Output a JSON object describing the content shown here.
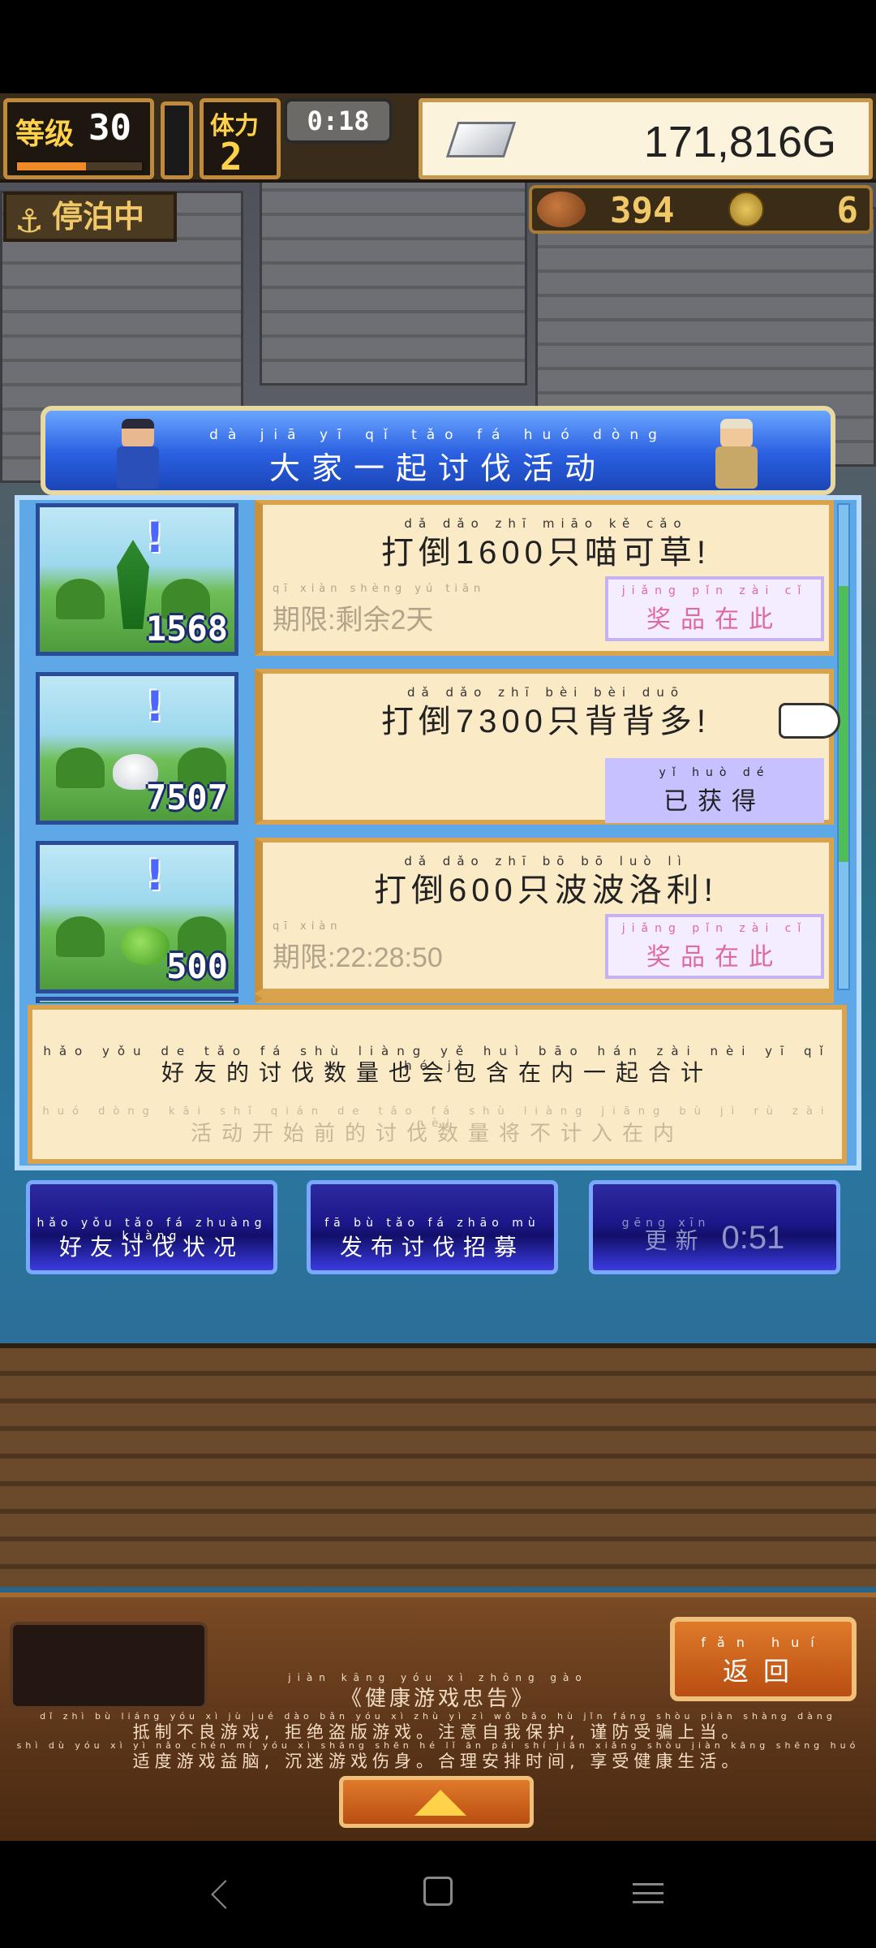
{
  "hud": {
    "level_label": "等级",
    "level_value": "30",
    "exp_fraction": 0.55,
    "stamina_label": "体力",
    "stamina_value": "2",
    "timer": "0:18",
    "money": "171,816G"
  },
  "status": {
    "dock_label": "停泊中",
    "meat_value": "394",
    "coin_value": "6"
  },
  "event": {
    "title_ruby": "dà jiā yī qǐ tǎo fá huó dòng",
    "title": "大家一起讨伐活动",
    "quests": [
      {
        "ruby": "dǎ dǎo zhī miāo kě cǎo",
        "text": "打倒1600只喵可草!",
        "count": "1568",
        "deadline_ruby": "qī xiàn shèng yú tiān",
        "deadline": "期限:剩余2天",
        "button_ruby": "jiǎng pǐn zài cǐ",
        "button_label": "奖品在此",
        "button_state": "prize"
      },
      {
        "ruby": "dǎ dǎo zhī bèi bèi duō",
        "text": "打倒7300只背背多!",
        "count": "7507",
        "deadline_ruby": "",
        "deadline": "",
        "button_ruby": "yǐ huò dé",
        "button_label": "已获得",
        "button_state": "received"
      },
      {
        "ruby": "dǎ dǎo zhī bō bō luò lì",
        "text": "打倒600只波波洛利!",
        "count": "500",
        "deadline_ruby": "qī xiàn",
        "deadline": "期限:22:28:50",
        "button_ruby": "jiǎng pǐn zài cǐ",
        "button_label": "奖品在此",
        "button_state": "prize"
      }
    ],
    "notice": {
      "line1_ruby": "hǎo yǒu de tǎo fá shù liàng yě huì bāo hán zài nèi yī qǐ hé jì",
      "line1": "好友的讨伐数量也会包含在内一起合计",
      "line2_ruby": "huó dòng kāi shǐ qián de tǎo fá shù liàng jiāng bù jì rù zài nèi",
      "line2": "活动开始前的讨伐数量将不计入在内"
    }
  },
  "actions": {
    "friend_status_ruby": "hǎo yǒu tǎo fá zhuàng kuàng",
    "friend_status": "好友讨伐状况",
    "recruit_ruby": "fā bù tǎo fá zhāo mù",
    "recruit": "发布讨伐招募",
    "refresh_ruby": "gēng xīn",
    "refresh": "更新",
    "refresh_timer": "0:51"
  },
  "bottom": {
    "back_ruby": "fǎn huí",
    "back": "返回",
    "health_title_ruby": "jiàn kāng yóu xì zhōng gào",
    "health_title": "《健康游戏忠告》",
    "health_line1_ruby": "dǐ zhì bù liáng yóu xì jù jué dào bǎn yóu xì zhù yì zì wǒ bǎo hù jǐn fáng shòu piàn shàng dàng",
    "health_line1": "抵制不良游戏, 拒绝盗版游戏。注意自我保护, 谨防受骗上当。",
    "health_line2_ruby": "shì dù yóu xì yì nǎo chén mí yóu xì shāng shēn hé lǐ ān pái shí jiān xiǎng shòu jiàn kāng shēng huó",
    "health_line2": "适度游戏益脑, 沉迷游戏伤身。合理安排时间, 享受健康生活。"
  }
}
